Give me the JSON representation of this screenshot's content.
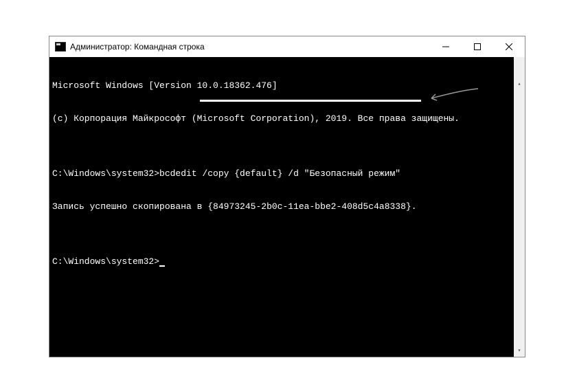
{
  "window": {
    "title": "Администратор: Командная строка"
  },
  "console": {
    "version_line": "Microsoft Windows [Version 10.0.18362.476]",
    "copyright_line": "(c) Корпорация Майкрософт (Microsoft Corporation), 2019. Все права защищены.",
    "blank1": "",
    "prompt1_path": "C:\\Windows\\system32>",
    "prompt1_cmd": "bcdedit /copy {default} /d \"Безопасный режим\"",
    "result_prefix": "Запись успешно скопирована в ",
    "result_guid": "{84973245-2b0c-11ea-bbe2-408d5c4a8338}",
    "result_suffix": ".",
    "blank2": "",
    "prompt2_path": "C:\\Windows\\system32>"
  }
}
